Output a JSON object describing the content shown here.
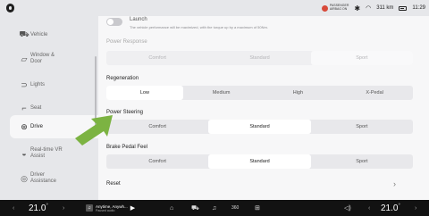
{
  "status_bar": {
    "airbag_line1": "PASSENGER",
    "airbag_line2": "AIRBAG ON",
    "bluetooth_icon": "bluetooth-icon",
    "wifi_icon": "wifi-icon",
    "range": "311 km",
    "time": "11:29"
  },
  "sidebar": {
    "items": [
      {
        "label": "Vehicle",
        "icon": "car-icon"
      },
      {
        "label": "Window & Door",
        "icon": "window-icon"
      },
      {
        "label": "Lights",
        "icon": "lights-icon"
      },
      {
        "label": "Seat",
        "icon": "seat-icon"
      },
      {
        "label": "Drive",
        "icon": "steering-wheel-icon",
        "active": true
      },
      {
        "label": "Real-time VR Assist",
        "icon": "vr-assist-icon"
      },
      {
        "label": "Driver Assistance",
        "icon": "driver-assist-icon"
      }
    ]
  },
  "content": {
    "launch": {
      "title": "Launch",
      "description": "The vehicle performance will be maximized, with the torque up by a maximum of 50Nm."
    },
    "power_response": {
      "label": "Power Response",
      "options": [
        "Comfort",
        "Standard",
        "Sport"
      ],
      "selected": "Sport",
      "enabled": false
    },
    "regeneration": {
      "label": "Regeneration",
      "options": [
        "Low",
        "Medium",
        "High",
        "X-Pedal"
      ],
      "selected": "Low"
    },
    "power_steering": {
      "label": "Power Steering",
      "options": [
        "Comfort",
        "Standard",
        "Sport"
      ],
      "selected": "Standard"
    },
    "brake_pedal_feel": {
      "label": "Brake Pedal Feel",
      "options": [
        "Comfort",
        "Standard",
        "Sport"
      ],
      "selected": "Standard"
    },
    "reset": {
      "label": "Reset"
    }
  },
  "dock": {
    "temp_left": "21.0",
    "temp_right": "21.0",
    "temp_unit": "°",
    "media_title": "Anytime, Anywh...",
    "media_subtitle": "Paused audio",
    "icons": [
      "home-icon",
      "car-icon",
      "music-icon",
      "360-camera-icon",
      "apps-grid-icon",
      "volume-icon"
    ],
    "icon_360_label": "360"
  },
  "colors": {
    "background": "#e6e7ea",
    "panel": "#f7f7f8",
    "selected_segment": "#ffffff",
    "arrow": "#7cb342",
    "dock": "#121212"
  }
}
